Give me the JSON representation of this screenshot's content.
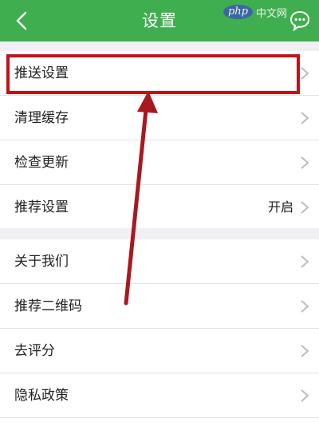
{
  "header": {
    "title": "设置",
    "watermark_logo": "php",
    "watermark_text": "中文网"
  },
  "settings_group_1": [
    {
      "label": "推送设置",
      "value": ""
    },
    {
      "label": "清理缓存",
      "value": ""
    },
    {
      "label": "检查更新",
      "value": ""
    },
    {
      "label": "推荐设置",
      "value": "开启"
    }
  ],
  "settings_group_2": [
    {
      "label": "关于我们"
    },
    {
      "label": "推荐二维码"
    },
    {
      "label": "去评分"
    },
    {
      "label": "隐私政策"
    }
  ],
  "colors": {
    "header_bg": "#3fae4e",
    "highlight": "#c0121a",
    "arrow": "#a9181f"
  }
}
